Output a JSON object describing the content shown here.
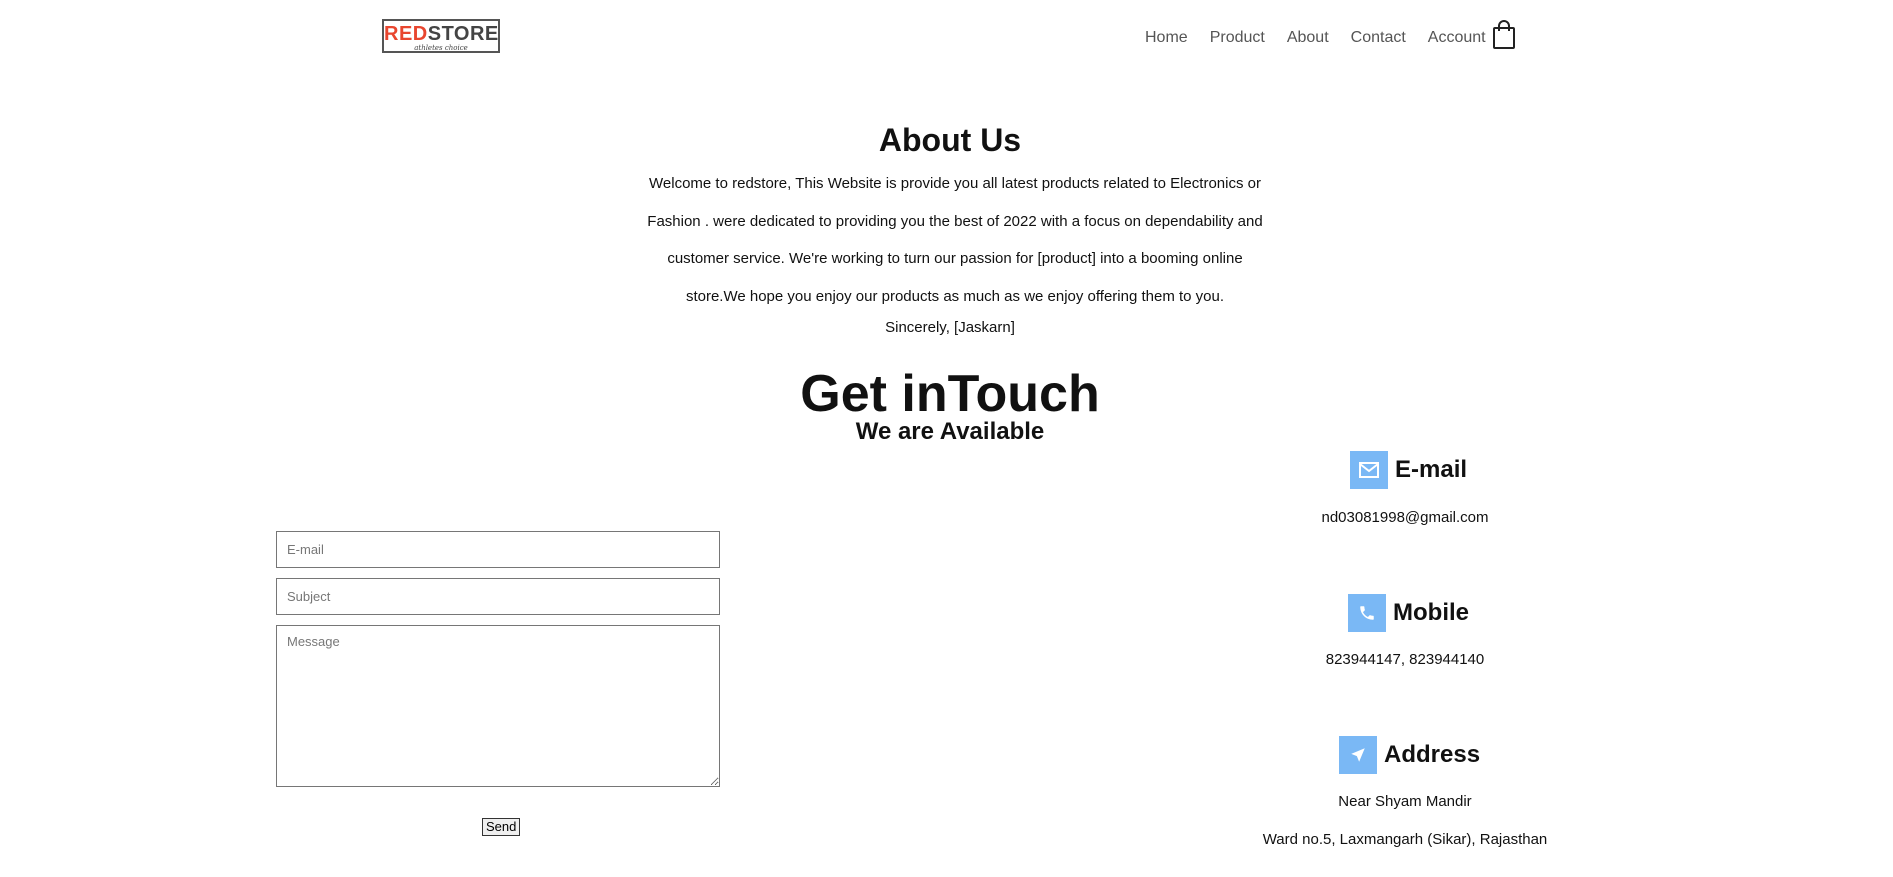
{
  "logo": {
    "red": "RED",
    "rest": "STORE",
    "tagline": "athletes choice"
  },
  "nav": [
    "Home",
    "Product",
    "About",
    "Contact",
    "Account"
  ],
  "about": {
    "title": "About Us",
    "text": "Welcome to redstore, This Website is provide you all latest products related to Electronics or Fashion . were dedicated to providing you the best of 2022 with a focus on dependability and customer service. We're working to turn our passion for [product] into a booming online store.We hope you enjoy our products as much as we enjoy offering them to you.",
    "signoff": "Sincerely, [Jaskarn]"
  },
  "touch": {
    "title": "Get inTouch",
    "subtitle": "We are Available"
  },
  "form": {
    "email_placeholder": "E-mail",
    "subject_placeholder": "Subject",
    "message_placeholder": "Message",
    "send_label": "Send"
  },
  "contact": {
    "email": {
      "title": "E-mail",
      "value": "nd03081998@gmail.com",
      "icon": "envelope-icon"
    },
    "mobile": {
      "title": "Mobile",
      "value": "823944147, 823944140",
      "icon": "phone-icon"
    },
    "address": {
      "title": "Address",
      "line1": "Near Shyam Mandir",
      "line2": "Ward no.5, Laxmangarh (Sikar), Rajasthan",
      "icon": "location-arrow-icon"
    }
  },
  "colors": {
    "accent_red": "#e8462f",
    "icon_bg": "#7ab8f5"
  }
}
